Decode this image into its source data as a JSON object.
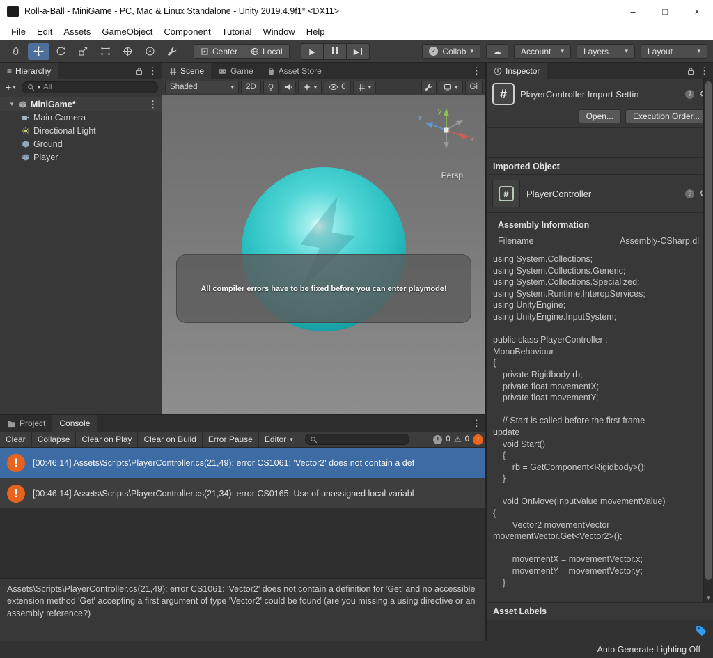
{
  "colors": {
    "selection_blue": "#3d6ca5",
    "error_orange": "#e8641e",
    "sphere_teal": "#2bbfc2",
    "tag_blue": "#2f9df4"
  },
  "icons": {
    "kebab": "⋮",
    "caret": "▾",
    "plus": "+",
    "hamburger": "≡",
    "cloud": "☁",
    "gear": "⚙",
    "help": "?",
    "warning": "⚠",
    "play": "▶",
    "exclaim": "!",
    "check": "✓",
    "hash": "#",
    "fold_open": "▼",
    "minimize": "–",
    "maximize": "□",
    "close": "×",
    "scroll_down": "▼"
  },
  "window": {
    "title": "Roll-a-Ball - MiniGame - PC, Mac & Linux Standalone - Unity 2019.4.9f1* <DX11>"
  },
  "menubar": {
    "items": [
      "File",
      "Edit",
      "Assets",
      "GameObject",
      "Component",
      "Tutorial",
      "Window",
      "Help"
    ]
  },
  "toolbar": {
    "pivot": "Center",
    "space": "Local",
    "collab": "Collab",
    "account": "Account",
    "layers": "Layers",
    "layout": "Layout"
  },
  "hierarchy": {
    "tab": "Hierarchy",
    "search_value": "All",
    "scene": "MiniGame*",
    "items": [
      "Main Camera",
      "Directional Light",
      "Ground",
      "Player"
    ]
  },
  "scene": {
    "tabs": [
      "Scene",
      "Game",
      "Asset Store"
    ],
    "shaded": "Shaded",
    "mode_2d": "2D",
    "visibility_count": "0",
    "gizmos_clipped": "Gi",
    "persp": "Persp",
    "axis_x": "x",
    "axis_y": "y",
    "axis_z": "z",
    "toast": "All compiler errors have to be fixed before you can enter playmode!"
  },
  "console": {
    "tab_project": "Project",
    "tab_console": "Console",
    "buttons": [
      "Clear",
      "Collapse",
      "Clear on Play",
      "Clear on Build",
      "Error Pause",
      "Editor"
    ],
    "info_count": "0",
    "warning_count": "0",
    "entries": [
      "[00:46:14] Assets\\Scripts\\PlayerController.cs(21,49): error CS1061: 'Vector2' does not contain a def",
      "[00:46:14] Assets\\Scripts\\PlayerController.cs(21,34): error CS0165: Use of unassigned local variabl"
    ],
    "detail": "Assets\\Scripts\\PlayerController.cs(21,49): error CS1061: 'Vector2' does not contain a definition for 'Get' and no accessible extension method 'Get' accepting a first argument of type 'Vector2' could be found (are you missing a using directive or an assembly reference?)"
  },
  "inspector": {
    "tab": "Inspector",
    "title": "PlayerController Import Settin",
    "open_button": "Open...",
    "exec_button": "Execution Order...",
    "imported_object": "Imported Object",
    "script_name": "PlayerController",
    "assembly_info": "Assembly Information",
    "filename_label": "Filename",
    "filename_value": "Assembly-CSharp.dl",
    "code_lines": [
      "using System.Collections;",
      "using System.Collections.Generic;",
      "using System.Collections.Specialized;",
      "using System.Runtime.InteropServices;",
      "using UnityEngine;",
      "using UnityEngine.InputSystem;",
      "",
      "public class PlayerController :",
      "MonoBehaviour",
      "{",
      "    private Rigidbody rb;",
      "    private float movementX;",
      "    private float movementY;",
      "",
      "    // Start is called before the first frame",
      "update",
      "    void Start()",
      "    {",
      "        rb = GetComponent<Rigidbody>();",
      "    }",
      "",
      "    void OnMove(InputValue movementValue)",
      "{",
      "        Vector2 movementVector =",
      "movementVector.Get<Vector2>();",
      "",
      "        movementX = movementVector.x;",
      "        movementY = movementVector.y;",
      "    }",
      "",
      "    // Update is called once per frame"
    ],
    "asset_labels": "Asset Labels"
  },
  "statusbar": {
    "right": "Auto Generate Lighting Off"
  }
}
